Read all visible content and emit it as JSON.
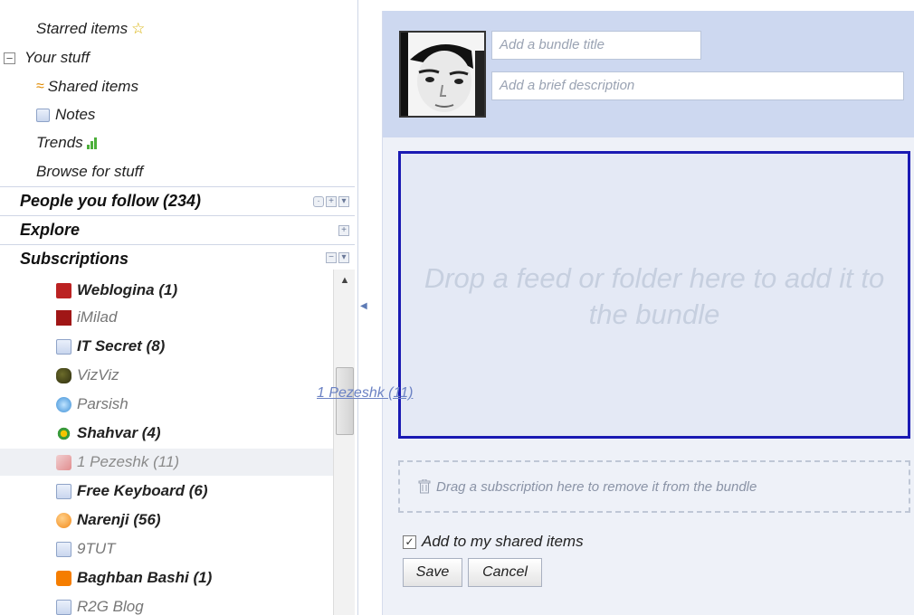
{
  "nav": {
    "starred": "Starred items",
    "your_stuff": "Your stuff",
    "shared": "Shared items",
    "notes": "Notes",
    "trends": "Trends",
    "browse": "Browse for stuff"
  },
  "sections": {
    "people": "People you follow (234)",
    "explore": "Explore",
    "subscriptions": "Subscriptions"
  },
  "subscriptions": [
    {
      "label": "Weblogina (1)",
      "icon": "flag-icon",
      "style": "bold"
    },
    {
      "label": "iMilad",
      "icon": "site-icon",
      "style": "light"
    },
    {
      "label": "IT Secret (8)",
      "icon": "feed-icon",
      "style": "bold"
    },
    {
      "label": "VizViz",
      "icon": "bird-icon",
      "style": "light"
    },
    {
      "label": "Parsish",
      "icon": "globe-icon",
      "style": "light"
    },
    {
      "label": "Shahvar (4)",
      "icon": "flower-icon",
      "style": "bold"
    },
    {
      "label": "1 Pezeshk (11)",
      "icon": "ribbon-icon",
      "style": "selected"
    },
    {
      "label": "Free Keyboard (6)",
      "icon": "feed-icon",
      "style": "bold"
    },
    {
      "label": "Narenji (56)",
      "icon": "orange-icon",
      "style": "bold"
    },
    {
      "label": "9TUT",
      "icon": "feed-icon",
      "style": "light"
    },
    {
      "label": "Baghban Bashi (1)",
      "icon": "blogger-icon",
      "style": "bold"
    },
    {
      "label": "R2G Blog",
      "icon": "feed-icon",
      "style": "light"
    }
  ],
  "drag_ghost": "1 Pezeshk (11)",
  "bundle": {
    "title_placeholder": "Add a bundle title",
    "desc_placeholder": "Add a brief description",
    "drop_text": "Drop a feed or folder here to add it to the bundle",
    "remove_text": "Drag a subscription here to remove it from the bundle",
    "shared_label": "Add to my shared items",
    "shared_checked": true,
    "save": "Save",
    "cancel": "Cancel"
  },
  "colors": {
    "accent_border": "#1a1ab3",
    "panel_bg": "#eef1f8",
    "panel_header": "#cdd8f0"
  }
}
